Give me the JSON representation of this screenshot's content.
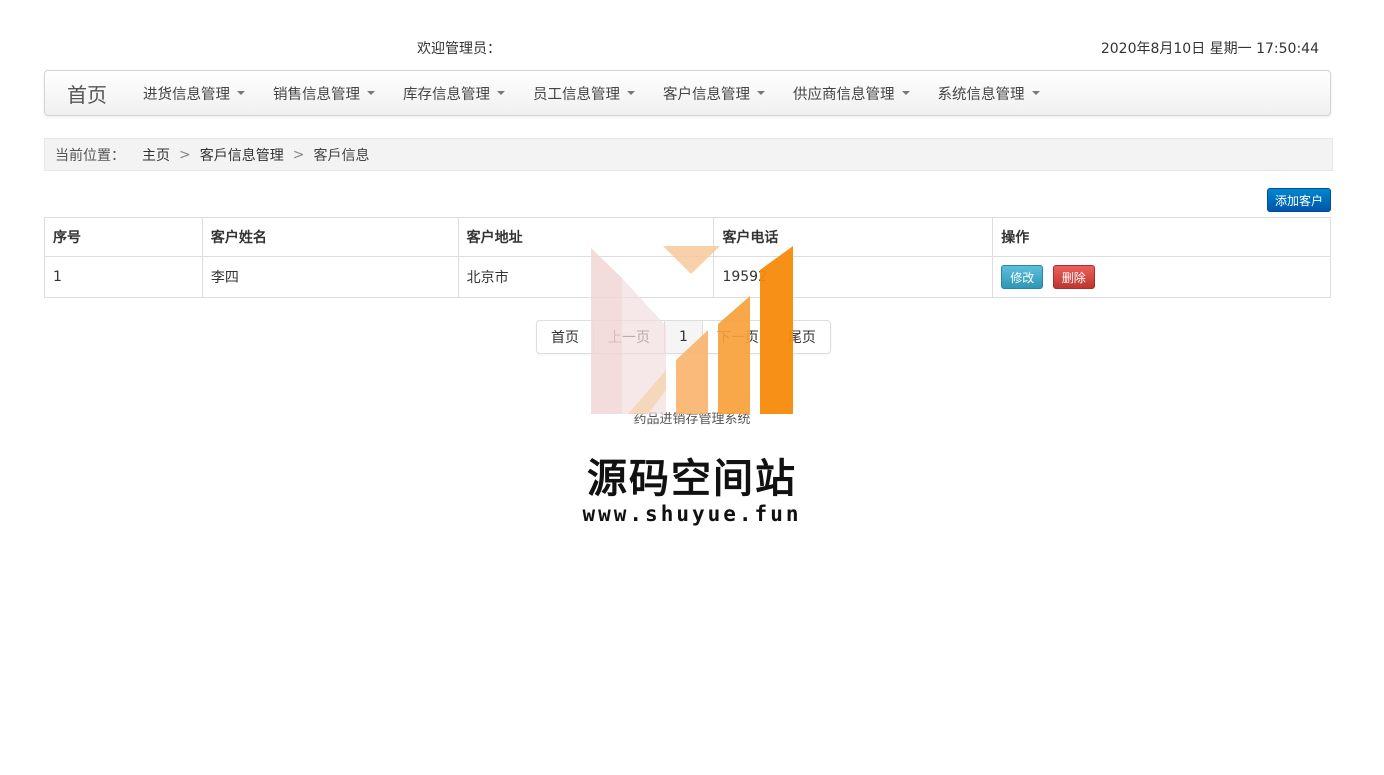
{
  "header": {
    "welcome": "欢迎管理员：",
    "datetime": "2020年8月10日 星期一 17:50:44"
  },
  "navbar": {
    "brand": "首页",
    "items": [
      {
        "label": "进货信息管理"
      },
      {
        "label": "销售信息管理"
      },
      {
        "label": "库存信息管理"
      },
      {
        "label": "员工信息管理"
      },
      {
        "label": "客户信息管理"
      },
      {
        "label": "供应商信息管理"
      },
      {
        "label": "系统信息管理"
      }
    ]
  },
  "breadcrumb": {
    "prefix": "当前位置：",
    "items": [
      "主页",
      "客戶信息管理",
      "客戶信息"
    ],
    "separator": ">"
  },
  "toolbar": {
    "add_label": "添加客户"
  },
  "table": {
    "columns": [
      "序号",
      "客户姓名",
      "客户地址",
      "客户电话",
      "操作"
    ],
    "rows": [
      {
        "index": "1",
        "name": "李四",
        "address": "北京市",
        "phone": "19592",
        "edit_label": "修改",
        "delete_label": "删除"
      }
    ]
  },
  "pagination": {
    "first": "首页",
    "prev": "上一页",
    "current": "1",
    "next": "下一页",
    "last": "尾页"
  },
  "footer": {
    "text": "药品进销存管理系统"
  },
  "watermark": {
    "title": "源码空间站",
    "url": "www.shuyue.fun"
  },
  "colors": {
    "primary": "#0066bb",
    "info": "#49afcd",
    "danger": "#da4f49",
    "watermark_orange": "#f58a0b",
    "watermark_pink": "#f0d6d6"
  }
}
